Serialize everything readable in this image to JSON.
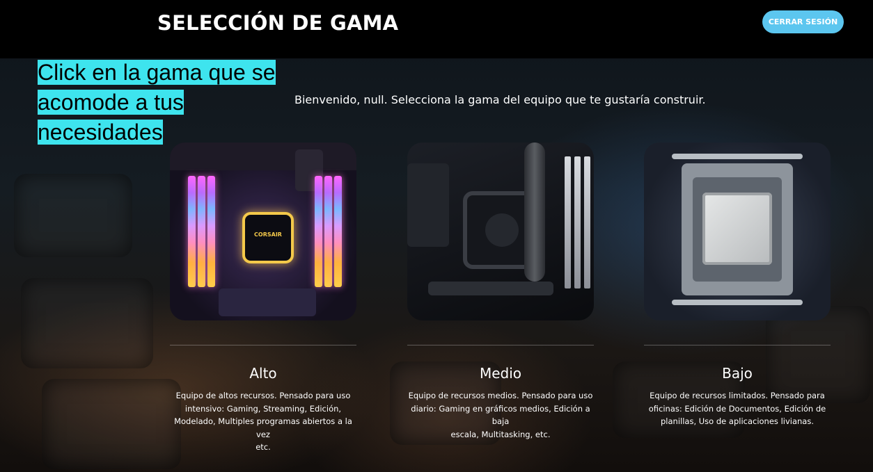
{
  "header": {
    "title": "SELECCIÓN DE GAMA",
    "logout_label": "CERRAR SESIÓN"
  },
  "hint": {
    "line1": "Click en la gama que se",
    "line2": "acomode a tus",
    "line3": "necesidades"
  },
  "welcome": "Bienvenido, null. Selecciona la gama del equipo que te gustaría construir.",
  "cards": [
    {
      "title": "Alto",
      "desc_lines": [
        "Equipo de altos recursos. Pensado para uso",
        "intensivo: Gaming, Streaming, Edición,",
        "Modelado, Multiples programas abiertos a la vez",
        "etc."
      ],
      "image_text": "CORSAIR"
    },
    {
      "title": "Medio",
      "desc_lines": [
        "Equipo de recursos medios. Pensado para uso",
        "diario: Gaming en gráficos medios, Edición a baja",
        "escala, Multitasking, etc."
      ]
    },
    {
      "title": "Bajo",
      "desc_lines": [
        "Equipo de recursos limitados. Pensado para",
        "oficinas: Edición de Documentos, Edición de",
        "planillas, Uso de aplicaciones livianas."
      ]
    }
  ],
  "colors": {
    "header_bg": "#000000",
    "button_bg": "#5cc6ef",
    "hint_highlight": "#3ee4ee"
  }
}
